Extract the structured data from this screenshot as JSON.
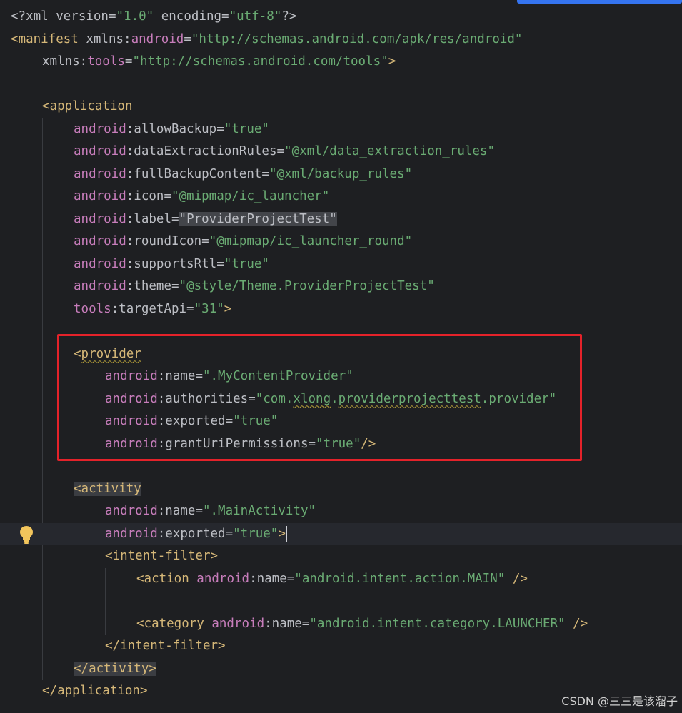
{
  "editor": {
    "lines": [
      {
        "indent": 0,
        "current": false,
        "tokens": [
          {
            "t": "<?xml version=",
            "c": "punct"
          },
          {
            "t": "\"1.0\"",
            "c": "val"
          },
          {
            "t": " encoding=",
            "c": "punct"
          },
          {
            "t": "\"utf-8\"",
            "c": "val"
          },
          {
            "t": "?>",
            "c": "punct"
          }
        ]
      },
      {
        "indent": 0,
        "current": false,
        "tokens": [
          {
            "t": "<manifest ",
            "c": "tag"
          },
          {
            "t": "xmlns:",
            "c": "attr"
          },
          {
            "t": "android",
            "c": "ns"
          },
          {
            "t": "=",
            "c": "attr"
          },
          {
            "t": "\"http://schemas.android.com/apk/res/android\"",
            "c": "val"
          }
        ]
      },
      {
        "indent": 1,
        "current": false,
        "tokens": [
          {
            "t": "xmlns:",
            "c": "attr"
          },
          {
            "t": "tools",
            "c": "ns"
          },
          {
            "t": "=",
            "c": "attr"
          },
          {
            "t": "\"http://schemas.android.com/tools\"",
            "c": "val"
          },
          {
            "t": ">",
            "c": "tag"
          }
        ]
      },
      {
        "indent": 0,
        "current": false,
        "tokens": []
      },
      {
        "indent": 1,
        "current": false,
        "tokens": [
          {
            "t": "<application",
            "c": "tag"
          }
        ]
      },
      {
        "indent": 2,
        "current": false,
        "tokens": [
          {
            "t": "android",
            "c": "ns"
          },
          {
            "t": ":allowBackup=",
            "c": "attr"
          },
          {
            "t": "\"true\"",
            "c": "val"
          }
        ]
      },
      {
        "indent": 2,
        "current": false,
        "tokens": [
          {
            "t": "android",
            "c": "ns"
          },
          {
            "t": ":dataExtractionRules=",
            "c": "attr"
          },
          {
            "t": "\"@xml/data_extraction_rules\"",
            "c": "val"
          }
        ]
      },
      {
        "indent": 2,
        "current": false,
        "tokens": [
          {
            "t": "android",
            "c": "ns"
          },
          {
            "t": ":fullBackupContent=",
            "c": "attr"
          },
          {
            "t": "\"@xml/backup_rules\"",
            "c": "val"
          }
        ]
      },
      {
        "indent": 2,
        "current": false,
        "tokens": [
          {
            "t": "android",
            "c": "ns"
          },
          {
            "t": ":icon=",
            "c": "attr"
          },
          {
            "t": "\"@mipmap/ic_launcher\"",
            "c": "val"
          }
        ]
      },
      {
        "indent": 2,
        "current": false,
        "tokens": [
          {
            "t": "android",
            "c": "ns"
          },
          {
            "t": ":label=",
            "c": "attr"
          },
          {
            "t": "\"ProviderProjectTest\"",
            "c": "sel"
          }
        ]
      },
      {
        "indent": 2,
        "current": false,
        "tokens": [
          {
            "t": "android",
            "c": "ns"
          },
          {
            "t": ":roundIcon=",
            "c": "attr"
          },
          {
            "t": "\"@mipmap/ic_launcher_round\"",
            "c": "val"
          }
        ]
      },
      {
        "indent": 2,
        "current": false,
        "tokens": [
          {
            "t": "android",
            "c": "ns"
          },
          {
            "t": ":supportsRtl=",
            "c": "attr"
          },
          {
            "t": "\"true\"",
            "c": "val"
          }
        ]
      },
      {
        "indent": 2,
        "current": false,
        "tokens": [
          {
            "t": "android",
            "c": "ns"
          },
          {
            "t": ":theme=",
            "c": "attr"
          },
          {
            "t": "\"@style/Theme.ProviderProjectTest\"",
            "c": "val"
          }
        ]
      },
      {
        "indent": 2,
        "current": false,
        "tokens": [
          {
            "t": "tools",
            "c": "ns"
          },
          {
            "t": ":targetApi=",
            "c": "attr"
          },
          {
            "t": "\"31\"",
            "c": "val"
          },
          {
            "t": ">",
            "c": "tag"
          }
        ]
      },
      {
        "indent": 0,
        "current": false,
        "tokens": []
      },
      {
        "indent": 2,
        "current": false,
        "tokens": [
          {
            "t": "<",
            "c": "tag"
          },
          {
            "t": "provider",
            "c": "tag",
            "wavy": true
          }
        ]
      },
      {
        "indent": 3,
        "current": false,
        "tokens": [
          {
            "t": "android",
            "c": "ns"
          },
          {
            "t": ":name=",
            "c": "attr"
          },
          {
            "t": "\".MyContentProvider\"",
            "c": "val"
          }
        ]
      },
      {
        "indent": 3,
        "current": false,
        "tokens": [
          {
            "t": "android",
            "c": "ns"
          },
          {
            "t": ":authorities=",
            "c": "attr"
          },
          {
            "t": "\"com.",
            "c": "val"
          },
          {
            "t": "xlong",
            "c": "val",
            "wavy": true
          },
          {
            "t": ".",
            "c": "val"
          },
          {
            "t": "providerprojecttest",
            "c": "val",
            "wavy": true
          },
          {
            "t": ".provider\"",
            "c": "val"
          }
        ]
      },
      {
        "indent": 3,
        "current": false,
        "tokens": [
          {
            "t": "android",
            "c": "ns"
          },
          {
            "t": ":exported=",
            "c": "attr"
          },
          {
            "t": "\"true\"",
            "c": "val"
          }
        ]
      },
      {
        "indent": 3,
        "current": false,
        "tokens": [
          {
            "t": "android",
            "c": "ns"
          },
          {
            "t": ":grantUriPermissions=",
            "c": "attr"
          },
          {
            "t": "\"true\"",
            "c": "val"
          },
          {
            "t": "/>",
            "c": "tag"
          }
        ]
      },
      {
        "indent": 0,
        "current": false,
        "tokens": []
      },
      {
        "indent": 2,
        "current": false,
        "tokens": [
          {
            "t": "<activity",
            "c": "tag",
            "hl": true
          }
        ]
      },
      {
        "indent": 3,
        "current": false,
        "tokens": [
          {
            "t": "android",
            "c": "ns"
          },
          {
            "t": ":name=",
            "c": "attr"
          },
          {
            "t": "\".MainActivity\"",
            "c": "val"
          }
        ]
      },
      {
        "indent": 3,
        "current": true,
        "caret": true,
        "tokens": [
          {
            "t": "android",
            "c": "ns"
          },
          {
            "t": ":exported=",
            "c": "attr"
          },
          {
            "t": "\"true\"",
            "c": "val"
          },
          {
            "t": ">",
            "c": "tag"
          }
        ]
      },
      {
        "indent": 3,
        "current": false,
        "tokens": [
          {
            "t": "<intent-filter>",
            "c": "tag"
          }
        ]
      },
      {
        "indent": 4,
        "current": false,
        "tokens": [
          {
            "t": "<action ",
            "c": "tag"
          },
          {
            "t": "android",
            "c": "ns"
          },
          {
            "t": ":name=",
            "c": "attr"
          },
          {
            "t": "\"android.intent.action.MAIN\"",
            "c": "val"
          },
          {
            "t": " />",
            "c": "tag"
          }
        ]
      },
      {
        "indent": 0,
        "current": false,
        "tokens": []
      },
      {
        "indent": 4,
        "current": false,
        "tokens": [
          {
            "t": "<category ",
            "c": "tag"
          },
          {
            "t": "android",
            "c": "ns"
          },
          {
            "t": ":name=",
            "c": "attr"
          },
          {
            "t": "\"android.intent.category.LAUNCHER\"",
            "c": "val"
          },
          {
            "t": " />",
            "c": "tag"
          }
        ]
      },
      {
        "indent": 3,
        "current": false,
        "tokens": [
          {
            "t": "</intent-filter>",
            "c": "tag"
          }
        ]
      },
      {
        "indent": 2,
        "current": false,
        "tokens": [
          {
            "t": "</activity>",
            "c": "tag",
            "hl": true
          }
        ]
      },
      {
        "indent": 1,
        "current": false,
        "tokens": [
          {
            "t": "</application>",
            "c": "tag"
          }
        ]
      }
    ]
  },
  "gutter": {
    "intention_icon": "lightbulb-icon"
  },
  "highlight": {
    "target": "provider-block",
    "color": "#e4222a"
  },
  "scrollbar": {
    "icon": "scrollbar-thumb"
  },
  "watermark": {
    "text": "CSDN @三三是该溜子"
  },
  "colors": {
    "background": "#1e1f22",
    "tag": "#d5b778",
    "namespace": "#c77dbb",
    "value": "#6aab73",
    "text": "#bcbec4"
  }
}
